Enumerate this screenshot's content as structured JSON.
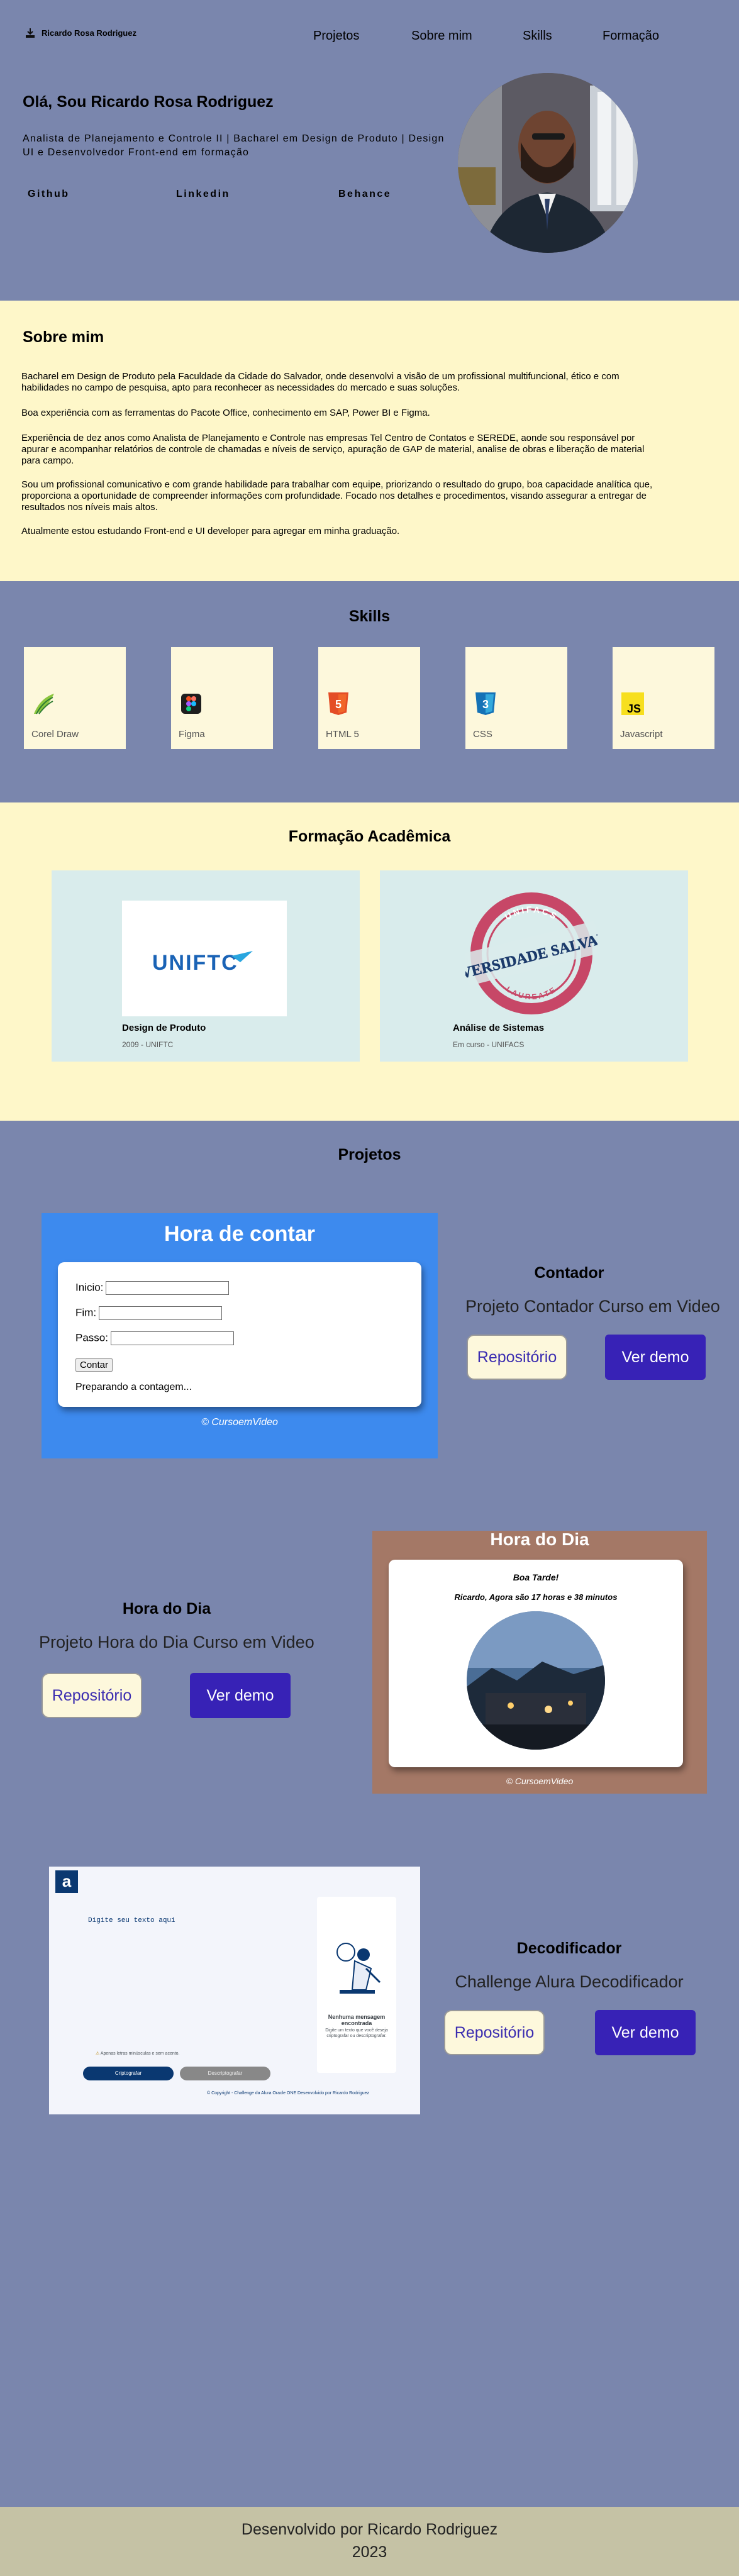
{
  "brand": {
    "name": "Ricardo Rosa Rodriguez"
  },
  "nav": [
    "Projetos",
    "Sobre mim",
    "Skills",
    "Formação"
  ],
  "hero": {
    "greeting": "Olá, Sou Ricardo Rosa Rodriguez",
    "subtitle": "Analista de Planejamento e Controle II | Bacharel em Design de Produto | Design UI e Desenvolvedor Front-end em formação",
    "links": [
      "Github",
      "Linkedin",
      "Behance"
    ]
  },
  "about": {
    "title": "Sobre mim",
    "paragraphs": [
      "Bacharel em Design de Produto pela Faculdade da Cidade do Salvador, onde desenvolvi a visão de um profissional multifuncional, ético e com habilidades no campo de pesquisa, apto para reconhecer as necessidades do mercado e suas soluções.",
      "Boa experiência com as ferramentas do Pacote Office, conhecimento em SAP, Power BI e Figma.",
      "Experiência de dez anos como Analista de Planejamento e Controle nas empresas Tel Centro de Contatos e SEREDE, aonde sou responsável por apurar e acompanhar relatórios de controle de chamadas e níveis de serviço, apuração de GAP de material, analise de obras e liberação de material para campo.",
      "Sou um profissional comunicativo e com grande habilidade para trabalhar com equipe, priorizando o resultado do grupo, boa capacidade analítica que, proporciona a oportunidade de compreender informações com profundidade. Focado nos detalhes e procedimentos, visando assegurar a entregar de resultados nos níveis mais altos.",
      "Atualmente estou estudando Front-end e UI developer para agregar em minha graduação."
    ]
  },
  "skills": {
    "title": "Skills",
    "items": [
      {
        "label": "Corel Draw",
        "icon": "coreldraw-icon"
      },
      {
        "label": "Figma",
        "icon": "figma-icon"
      },
      {
        "label": "HTML 5",
        "icon": "html5-icon"
      },
      {
        "label": "CSS",
        "icon": "css3-icon"
      },
      {
        "label": "Javascript",
        "icon": "javascript-icon"
      }
    ]
  },
  "education": {
    "title": "Formação Acadêmica",
    "items": [
      {
        "course": "Design de Produto",
        "detail": "2009 - UNIFTC",
        "logo_text": "UNIFTC"
      },
      {
        "course": "Análise de Sistemas",
        "detail": "Em curso - UNIFACS",
        "logo_ring_top": "UNIFACS",
        "logo_main": "UNIVERSIDADE SALVADOR",
        "logo_ring_bottom": "LAUREATE"
      }
    ]
  },
  "projects": {
    "title": "Projetos",
    "repo_label": "Repositório",
    "demo_label": "Ver demo",
    "items": [
      {
        "title": "Contador",
        "subtitle": "Projeto Contador Curso em Video",
        "preview": {
          "heading": "Hora de contar",
          "start_label": "Inicio:",
          "end_label": "Fim:",
          "step_label": "Passo:",
          "button": "Contar",
          "result": "Preparando a contagem...",
          "footer": "© CursoemVideo"
        }
      },
      {
        "title": "Hora do Dia",
        "subtitle": "Projeto Hora do Dia Curso em Video",
        "preview": {
          "heading": "Hora do Dia",
          "greeting": "Boa Tarde!",
          "time_text": "Ricardo, Agora são 17 horas e 38 minutos",
          "footer": "© CursoemVideo"
        }
      },
      {
        "title": "Decodificador",
        "subtitle": "Challenge Alura Decodificador",
        "preview": {
          "logo": "a",
          "placeholder": "Digite seu texto aqui",
          "empty_title": "Nenhuma mensagem encontrada",
          "empty_text": "Digite um texto que você deseja criptografar ou descriptografar.",
          "warning": "Apenas letras minúsculas e sem acento.",
          "encrypt": "Criptografar",
          "decrypt": "Descriptografar",
          "copyright": "© Copyright - Challenge da Alura Oracle ONE Desenvolvido por Ricardo Rodriguez"
        }
      }
    ]
  },
  "footer": {
    "line1": "Desenvolvido por Ricardo Rodriguez",
    "line2": "2023"
  },
  "colors": {
    "primary_bg": "#7a86ad",
    "cream": "#fef7c9",
    "accent": "#3722b6"
  }
}
